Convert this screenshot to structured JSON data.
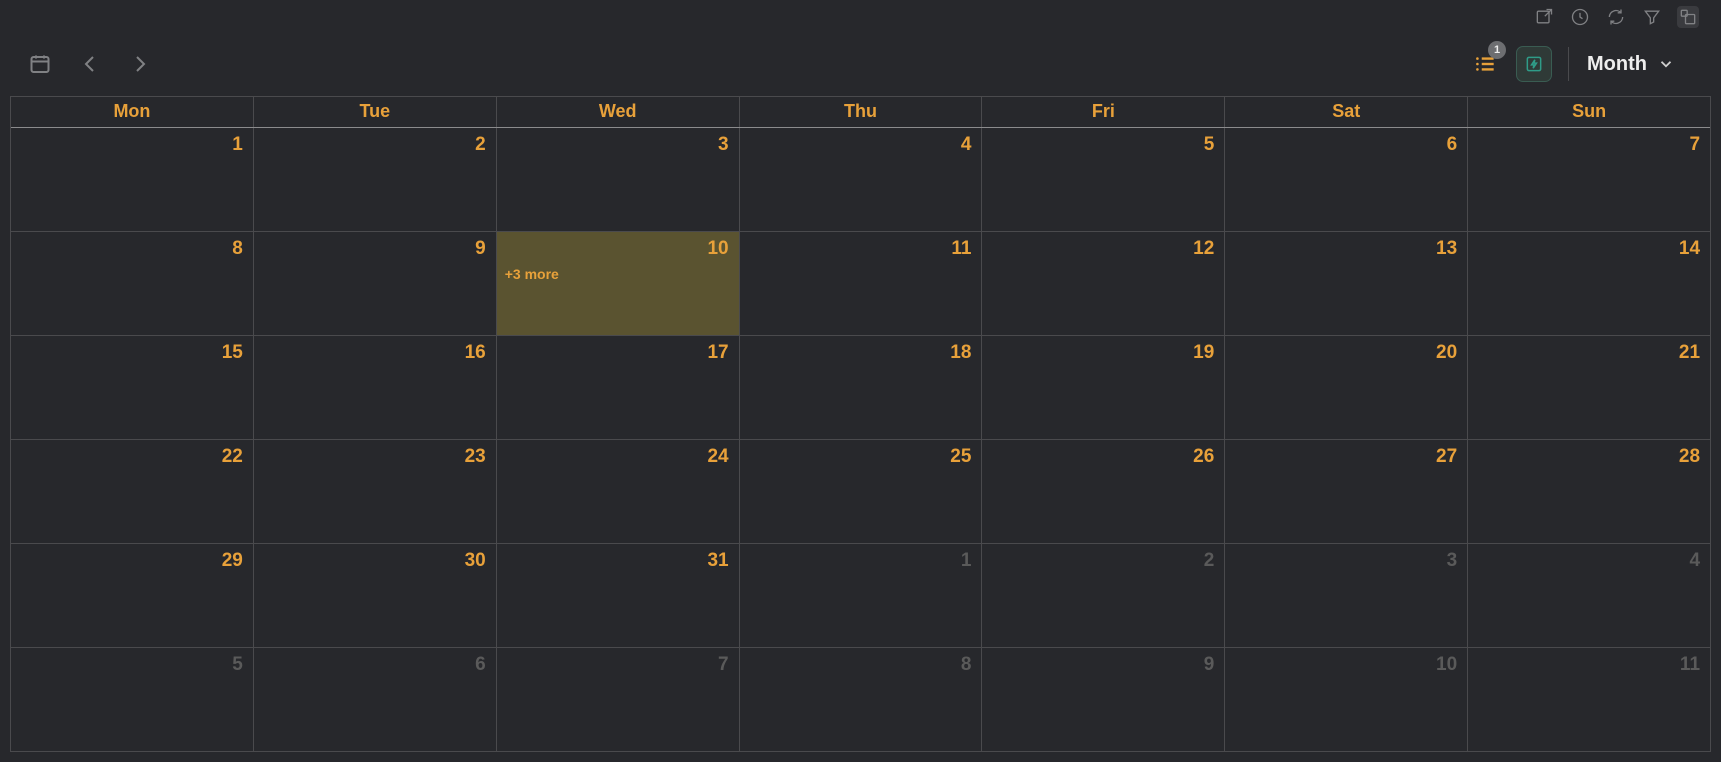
{
  "systemToolbar": {
    "export": "Export",
    "history": "History",
    "refresh": "Refresh",
    "filter": "Filter",
    "layout": "Layout"
  },
  "header": {
    "today": "Today",
    "prev": "Previous",
    "next": "Next",
    "listBadge": "1",
    "quickAction": "Quick action",
    "viewLabel": "Month"
  },
  "calendar": {
    "dayHeaders": [
      "Mon",
      "Tue",
      "Wed",
      "Thu",
      "Fri",
      "Sat",
      "Sun"
    ],
    "weeks": [
      [
        {
          "d": "1",
          "other": false,
          "hl": false,
          "more": null
        },
        {
          "d": "2",
          "other": false,
          "hl": false,
          "more": null
        },
        {
          "d": "3",
          "other": false,
          "hl": false,
          "more": null
        },
        {
          "d": "4",
          "other": false,
          "hl": false,
          "more": null
        },
        {
          "d": "5",
          "other": false,
          "hl": false,
          "more": null
        },
        {
          "d": "6",
          "other": false,
          "hl": false,
          "more": null
        },
        {
          "d": "7",
          "other": false,
          "hl": false,
          "more": null
        }
      ],
      [
        {
          "d": "8",
          "other": false,
          "hl": false,
          "more": null
        },
        {
          "d": "9",
          "other": false,
          "hl": false,
          "more": null
        },
        {
          "d": "10",
          "other": false,
          "hl": true,
          "more": "+3 more"
        },
        {
          "d": "11",
          "other": false,
          "hl": false,
          "more": null
        },
        {
          "d": "12",
          "other": false,
          "hl": false,
          "more": null
        },
        {
          "d": "13",
          "other": false,
          "hl": false,
          "more": null
        },
        {
          "d": "14",
          "other": false,
          "hl": false,
          "more": null
        }
      ],
      [
        {
          "d": "15",
          "other": false,
          "hl": false,
          "more": null
        },
        {
          "d": "16",
          "other": false,
          "hl": false,
          "more": null
        },
        {
          "d": "17",
          "other": false,
          "hl": false,
          "more": null
        },
        {
          "d": "18",
          "other": false,
          "hl": false,
          "more": null
        },
        {
          "d": "19",
          "other": false,
          "hl": false,
          "more": null
        },
        {
          "d": "20",
          "other": false,
          "hl": false,
          "more": null
        },
        {
          "d": "21",
          "other": false,
          "hl": false,
          "more": null
        }
      ],
      [
        {
          "d": "22",
          "other": false,
          "hl": false,
          "more": null
        },
        {
          "d": "23",
          "other": false,
          "hl": false,
          "more": null
        },
        {
          "d": "24",
          "other": false,
          "hl": false,
          "more": null
        },
        {
          "d": "25",
          "other": false,
          "hl": false,
          "more": null
        },
        {
          "d": "26",
          "other": false,
          "hl": false,
          "more": null
        },
        {
          "d": "27",
          "other": false,
          "hl": false,
          "more": null
        },
        {
          "d": "28",
          "other": false,
          "hl": false,
          "more": null
        }
      ],
      [
        {
          "d": "29",
          "other": false,
          "hl": false,
          "more": null
        },
        {
          "d": "30",
          "other": false,
          "hl": false,
          "more": null
        },
        {
          "d": "31",
          "other": false,
          "hl": false,
          "more": null
        },
        {
          "d": "1",
          "other": true,
          "hl": false,
          "more": null
        },
        {
          "d": "2",
          "other": true,
          "hl": false,
          "more": null
        },
        {
          "d": "3",
          "other": true,
          "hl": false,
          "more": null
        },
        {
          "d": "4",
          "other": true,
          "hl": false,
          "more": null
        }
      ],
      [
        {
          "d": "5",
          "other": true,
          "hl": false,
          "more": null
        },
        {
          "d": "6",
          "other": true,
          "hl": false,
          "more": null
        },
        {
          "d": "7",
          "other": true,
          "hl": false,
          "more": null
        },
        {
          "d": "8",
          "other": true,
          "hl": false,
          "more": null
        },
        {
          "d": "9",
          "other": true,
          "hl": false,
          "more": null
        },
        {
          "d": "10",
          "other": true,
          "hl": false,
          "more": null
        },
        {
          "d": "11",
          "other": true,
          "hl": false,
          "more": null
        }
      ]
    ]
  }
}
